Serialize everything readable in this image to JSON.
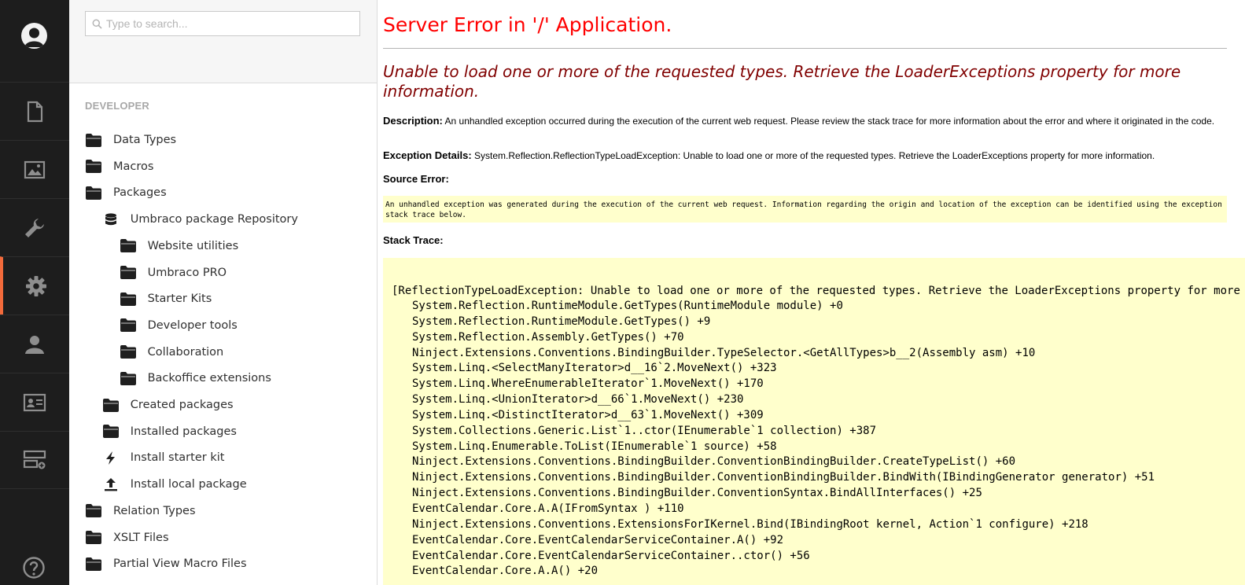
{
  "search": {
    "placeholder": "Type to search..."
  },
  "tree": {
    "section_title": "DEVELOPER",
    "items": [
      {
        "label": "Data Types",
        "icon": "folder-icon"
      },
      {
        "label": "Macros",
        "icon": "folder-icon"
      },
      {
        "label": "Packages",
        "icon": "folder-icon"
      },
      {
        "label": "Umbraco package Repository",
        "icon": "database-icon"
      },
      {
        "label": "Website utilities",
        "icon": "folder-icon"
      },
      {
        "label": "Umbraco PRO",
        "icon": "folder-icon"
      },
      {
        "label": "Starter Kits",
        "icon": "folder-icon"
      },
      {
        "label": "Developer tools",
        "icon": "folder-icon"
      },
      {
        "label": "Collaboration",
        "icon": "folder-icon"
      },
      {
        "label": "Backoffice extensions",
        "icon": "folder-icon"
      },
      {
        "label": "Created packages",
        "icon": "folder-icon"
      },
      {
        "label": "Installed packages",
        "icon": "folder-icon"
      },
      {
        "label": "Install starter kit",
        "icon": "lightning-icon"
      },
      {
        "label": "Install local package",
        "icon": "upload-icon"
      },
      {
        "label": "Relation Types",
        "icon": "folder-icon"
      },
      {
        "label": "XSLT Files",
        "icon": "folder-icon"
      },
      {
        "label": "Partial View Macro Files",
        "icon": "folder-icon"
      }
    ]
  },
  "nav": {
    "items": [
      "content-icon",
      "media-icon",
      "settings-wrench-icon",
      "developer-gear-icon",
      "users-icon",
      "members-icon",
      "forms-icon"
    ],
    "active_index": 3,
    "accent_color": "#f26a3b"
  },
  "error": {
    "title": "Server Error in '/' Application.",
    "heading": "Unable to load one or more of the requested types. Retrieve the LoaderExceptions property for more information.",
    "description_label": "Description:",
    "description_text": "An unhandled exception occurred during the execution of the current web request. Please review the stack trace for more information about the error and where it originated in the code.",
    "exception_label": "Exception Details:",
    "exception_text": "System.Reflection.ReflectionTypeLoadException: Unable to load one or more of the requested types. Retrieve the LoaderExceptions property for more information.",
    "source_error_label": "Source Error:",
    "source_error_text": "An unhandled exception was generated during the execution of the current web request. Information regarding the origin and location of the exception can be identified using the exception stack trace below.",
    "stack_trace_label": "Stack Trace:",
    "stack_first_line": "[ReflectionTypeLoadException: Unable to load one or more of the requested types. Retrieve the LoaderExceptions property for more information.]",
    "stack_lines": [
      "System.Reflection.RuntimeModule.GetTypes(RuntimeModule module) +0",
      "System.Reflection.RuntimeModule.GetTypes() +9",
      "System.Reflection.Assembly.GetTypes() +70",
      "Ninject.Extensions.Conventions.BindingBuilder.TypeSelector.<GetAllTypes>b__2(Assembly asm) +10",
      "System.Linq.<SelectManyIterator>d__16`2.MoveNext() +323",
      "System.Linq.WhereEnumerableIterator`1.MoveNext() +170",
      "System.Linq.<UnionIterator>d__66`1.MoveNext() +230",
      "System.Linq.<DistinctIterator>d__63`1.MoveNext() +309",
      "System.Collections.Generic.List`1..ctor(IEnumerable`1 collection) +387",
      "System.Linq.Enumerable.ToList(IEnumerable`1 source) +58",
      "Ninject.Extensions.Conventions.BindingBuilder.ConventionBindingBuilder.CreateTypeList() +60",
      "Ninject.Extensions.Conventions.BindingBuilder.ConventionBindingBuilder.BindWith(IBindingGenerator generator) +51",
      "Ninject.Extensions.Conventions.BindingBuilder.ConventionSyntax.BindAllInterfaces() +25",
      "EventCalendar.Core.A.A(IFromSyntax ) +110",
      "Ninject.Extensions.Conventions.ExtensionsForIKernel.Bind(IBindingRoot kernel, Action`1 configure) +218",
      "EventCalendar.Core.EventCalendarServiceContainer.A() +92",
      "EventCalendar.Core.EventCalendarServiceContainer..ctor() +56",
      "EventCalendar.Core.A.A() +20"
    ]
  }
}
